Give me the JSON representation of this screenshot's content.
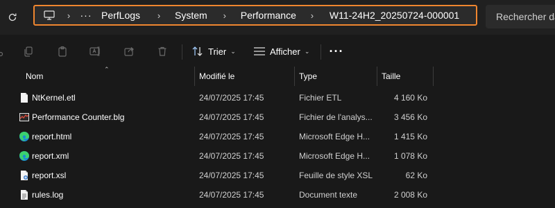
{
  "address": {
    "crumbs": [
      "PerfLogs",
      "System",
      "Performance",
      "W11-24H2_20250724-000001"
    ]
  },
  "search": {
    "placeholder": "Rechercher dans"
  },
  "toolbar": {
    "sort_label": "Trier",
    "view_label": "Afficher"
  },
  "columns": {
    "name": "Nom",
    "modified": "Modifié le",
    "type": "Type",
    "size": "Taille"
  },
  "files": [
    {
      "name": "NtKernel.etl",
      "modified": "24/07/2025 17:45",
      "type": "Fichier ETL",
      "size": "4 160 Ko",
      "icon": "generic-file-icon"
    },
    {
      "name": "Performance Counter.blg",
      "modified": "24/07/2025 17:45",
      "type": "Fichier de l'analys...",
      "size": "3 456 Ko",
      "icon": "perfmon-file-icon"
    },
    {
      "name": "report.html",
      "modified": "24/07/2025 17:45",
      "type": "Microsoft Edge H...",
      "size": "1 415 Ko",
      "icon": "edge-icon"
    },
    {
      "name": "report.xml",
      "modified": "24/07/2025 17:45",
      "type": "Microsoft Edge H...",
      "size": "1 078 Ko",
      "icon": "edge-icon"
    },
    {
      "name": "report.xsl",
      "modified": "24/07/2025 17:45",
      "type": "Feuille de style XSL",
      "size": "62 Ko",
      "icon": "xsl-file-icon"
    },
    {
      "name": "rules.log",
      "modified": "24/07/2025 17:45",
      "type": "Document texte",
      "size": "2 008 Ko",
      "icon": "text-file-icon"
    }
  ]
}
